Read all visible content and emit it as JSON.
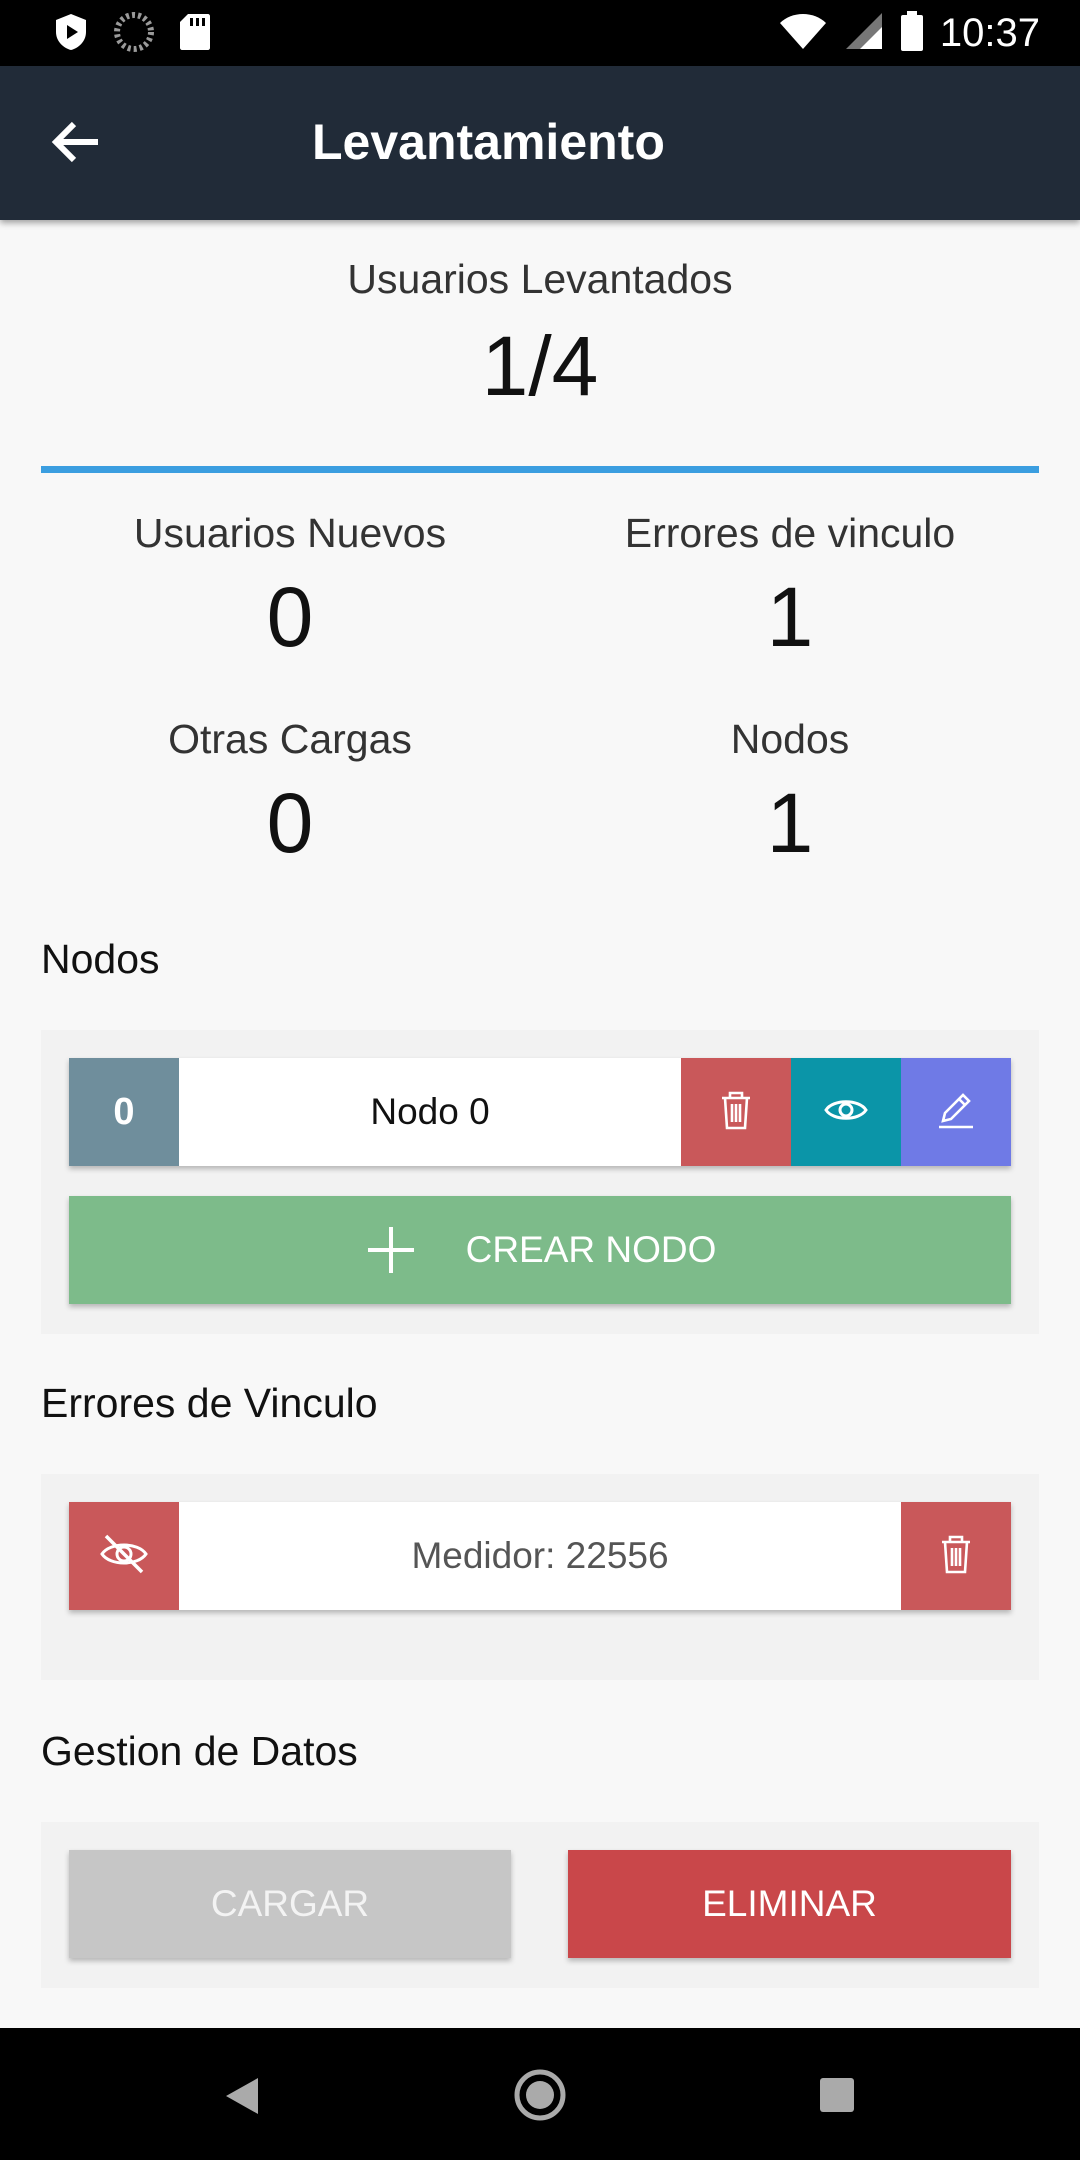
{
  "status_bar": {
    "time": "10:37"
  },
  "app_bar": {
    "title": "Levantamiento"
  },
  "summary": {
    "label": "Usuarios Levantados",
    "value": "1/4"
  },
  "stats": {
    "usuarios_nuevos": {
      "label": "Usuarios Nuevos",
      "value": "0"
    },
    "errores_vinculo": {
      "label": "Errores de vinculo",
      "value": "1"
    },
    "otras_cargas": {
      "label": "Otras Cargas",
      "value": "0"
    },
    "nodos": {
      "label": "Nodos",
      "value": "1"
    }
  },
  "nodos_section": {
    "title": "Nodos",
    "items": [
      {
        "index": "0",
        "name": "Nodo 0"
      }
    ],
    "create_label": "CREAR NODO"
  },
  "errores_section": {
    "title": "Errores de Vinculo",
    "items": [
      {
        "label": "Medidor: 22556"
      }
    ]
  },
  "gestion_section": {
    "title": "Gestion de Datos",
    "cargar_label": "CARGAR",
    "eliminar_label": "ELIMINAR"
  },
  "colors": {
    "app_bar": "#212b38",
    "accent_line": "#3b9ee0",
    "index_badge": "#6f8e9c",
    "delete": "#c9585a",
    "view": "#0b95a8",
    "edit": "#6f7ae6",
    "create": "#7dbb8a",
    "cargar_disabled": "#c6c6c6",
    "eliminar": "#c9474a"
  }
}
